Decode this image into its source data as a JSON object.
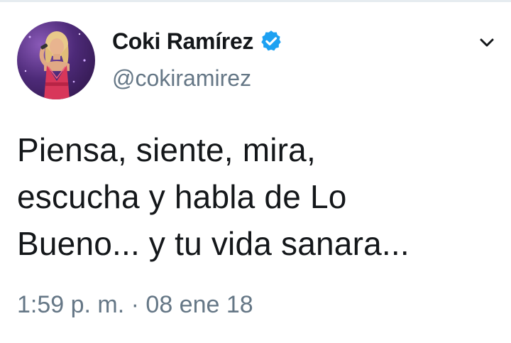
{
  "author": {
    "display_name": "Coki Ramírez",
    "handle": "@cokiramirez",
    "verified": true,
    "avatar_icon": "profile-photo-singer-icon"
  },
  "tweet": {
    "text": "Piensa, siente, mira,\nescucha y habla de Lo\nBueno... y tu vida sanara...",
    "timestamp": "1:59 p. m. · 08 ene 18"
  },
  "colors": {
    "verified_badge": "#1da1f2",
    "secondary_text": "#657786",
    "primary_text": "#14171a"
  },
  "icons": {
    "menu": "chevron-down-icon",
    "verified": "verified-badge-icon"
  }
}
